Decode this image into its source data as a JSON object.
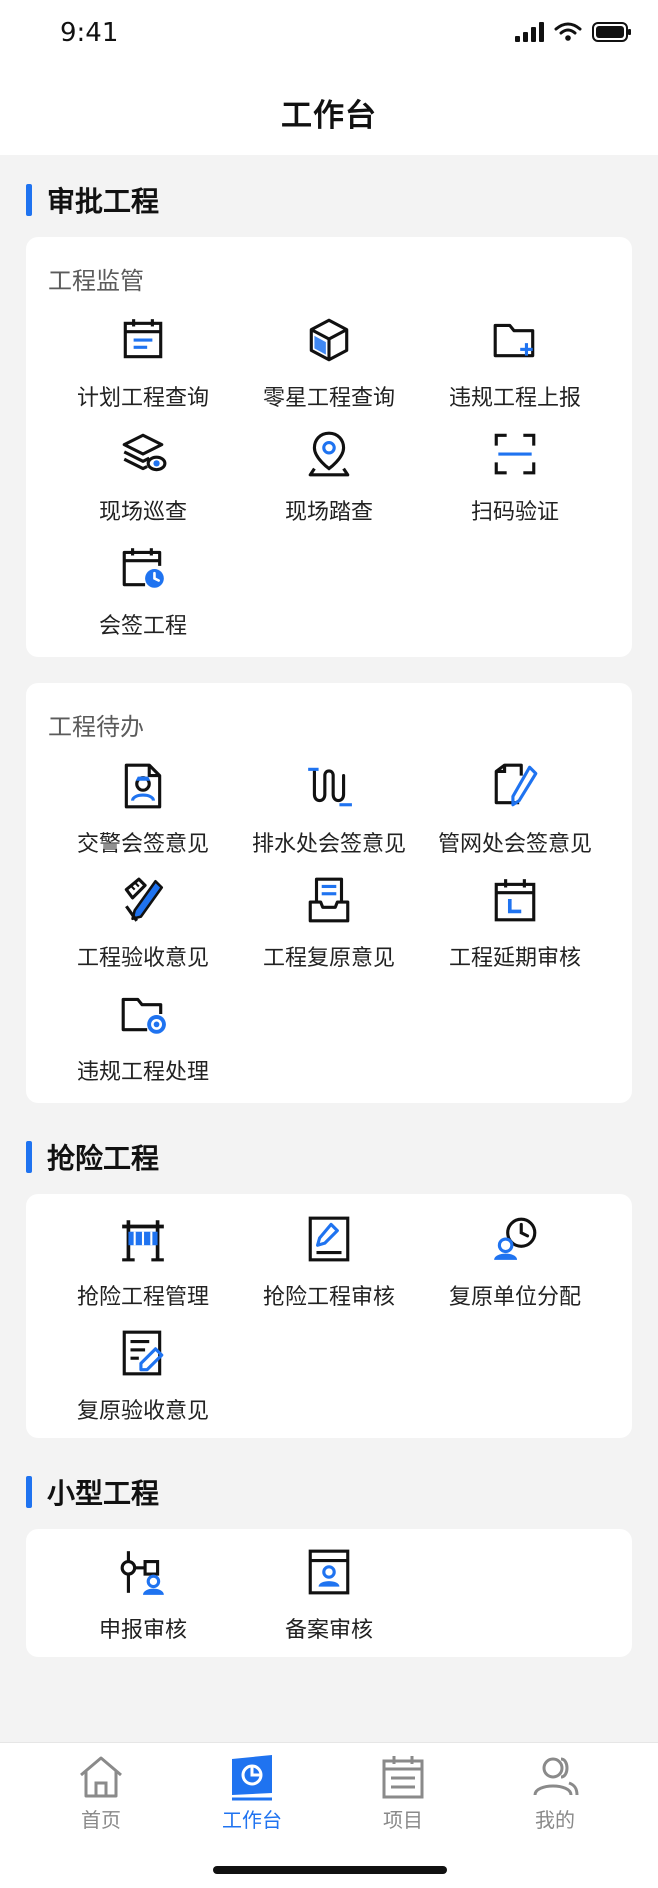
{
  "status_bar": {
    "time": "9:41"
  },
  "header": {
    "title": "工作台"
  },
  "sections": {
    "approval": {
      "title": "审批工程",
      "supervision": {
        "subtitle": "工程监管",
        "items": [
          {
            "label": "计划工程查询",
            "icon": "calendar-list-icon"
          },
          {
            "label": "零星工程查询",
            "icon": "cube-icon"
          },
          {
            "label": "违规工程上报",
            "icon": "folder-add-icon"
          },
          {
            "label": "现场巡查",
            "icon": "layers-eye-icon"
          },
          {
            "label": "现场踏查",
            "icon": "location-pin-icon"
          },
          {
            "label": "扫码验证",
            "icon": "scan-icon"
          },
          {
            "label": "会签工程",
            "icon": "calendar-clock-icon"
          }
        ]
      },
      "todo": {
        "subtitle": "工程待办",
        "items": [
          {
            "label": "交警会签意见",
            "icon": "police-document-icon"
          },
          {
            "label": "排水处会签意见",
            "icon": "drainage-pipe-icon"
          },
          {
            "label": "管网处会签意见",
            "icon": "note-pen-icon"
          },
          {
            "label": "工程验收意见",
            "icon": "ruler-pen-icon"
          },
          {
            "label": "工程复原意见",
            "icon": "document-tray-icon"
          },
          {
            "label": "工程延期审核",
            "icon": "calendar-l-icon"
          },
          {
            "label": "违规工程处理",
            "icon": "folder-gear-icon"
          }
        ]
      }
    },
    "emergency": {
      "title": "抢险工程",
      "items": [
        {
          "label": "抢险工程管理",
          "icon": "barrier-icon"
        },
        {
          "label": "抢险工程审核",
          "icon": "edit-document-icon"
        },
        {
          "label": "复原单位分配",
          "icon": "user-clock-icon"
        },
        {
          "label": "复原验收意见",
          "icon": "document-edit-icon"
        }
      ]
    },
    "small": {
      "title": "小型工程",
      "items": [
        {
          "label": "申报审核",
          "icon": "flow-user-icon"
        },
        {
          "label": "备案审核",
          "icon": "window-user-icon"
        }
      ]
    }
  },
  "tabbar": {
    "items": [
      {
        "label": "首页",
        "icon": "home-icon",
        "active": false
      },
      {
        "label": "工作台",
        "icon": "dashboard-icon",
        "active": true
      },
      {
        "label": "项目",
        "icon": "calendar-list-icon",
        "active": false
      },
      {
        "label": "我的",
        "icon": "users-icon",
        "active": false
      }
    ]
  },
  "colors": {
    "accent": "#1f73f0",
    "ink": "#111111",
    "muted": "#8a8a8a",
    "background": "#f3f3f3"
  }
}
